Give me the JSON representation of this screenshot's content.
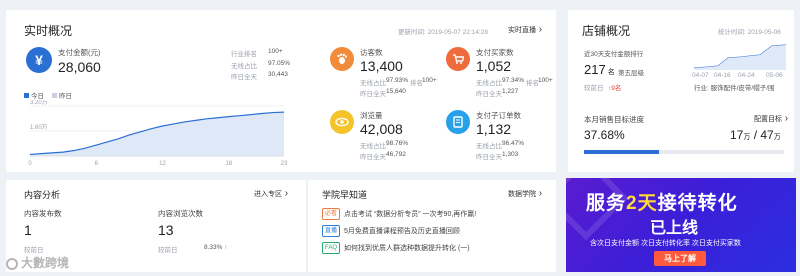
{
  "realtime": {
    "title": "实时概况",
    "updated": "更新时间: 2019-05-07 22:14:28",
    "live_link": "实时直播",
    "payment": {
      "label": "支付金额(元)",
      "value": "28,060",
      "stats": [
        {
          "label": "行业排名",
          "value": "100+"
        },
        {
          "label": "无线占比",
          "value": "97.05%"
        },
        {
          "label": "昨日全天",
          "value": "30,443"
        }
      ]
    },
    "legend_today": "今日",
    "legend_yesterday": "昨日",
    "metrics": [
      {
        "label": "访客数",
        "value": "13,400",
        "r1": "无线占比",
        "v1": "97.93%",
        "r1b": "排名",
        "v1b": "100+",
        "r2": "昨日全天",
        "v2": "15,640",
        "color": "#f08c3a",
        "icon": "footprint-icon"
      },
      {
        "label": "支付买家数",
        "value": "1,052",
        "r1": "无线占比",
        "v1": "97.34%",
        "r1b": "排名",
        "v1b": "100+",
        "r2": "昨日全天",
        "v2": "1,227",
        "color": "#ef6a3c",
        "icon": "cart-icon"
      },
      {
        "label": "浏览量",
        "value": "42,008",
        "r1": "无线占比",
        "v1": "98.76%",
        "r2": "昨日全天",
        "v2": "46,792",
        "color": "#f5c42c",
        "icon": "eye-icon"
      },
      {
        "label": "支付子订单数",
        "value": "1,132",
        "r1": "无线占比",
        "v1": "96.47%",
        "r2": "昨日全天",
        "v2": "1,303",
        "color": "#27a0e8",
        "icon": "order-icon"
      }
    ]
  },
  "chart_data": {
    "type": "area",
    "x": [
      0,
      1,
      2,
      3,
      4,
      5,
      6,
      7,
      8,
      9,
      10,
      11,
      12,
      13,
      14,
      15,
      16,
      17,
      18,
      19,
      20,
      21,
      22,
      23
    ],
    "xticks": [
      "0",
      "6",
      "12",
      "18",
      "23"
    ],
    "yticks": [
      "3.20万",
      "1.60万"
    ],
    "series": [
      {
        "name": "今日",
        "values": [
          0.1,
          0.15,
          0.2,
          0.25,
          0.35,
          0.5,
          0.7,
          0.9,
          1.1,
          1.35,
          1.55,
          1.75,
          1.92,
          2.05,
          2.18,
          2.28,
          2.38,
          2.45,
          2.52,
          2.58,
          2.65,
          2.72,
          2.78,
          2.81
        ]
      }
    ],
    "ylim": [
      0,
      3.2
    ],
    "grid": true
  },
  "shop": {
    "title": "店铺概况",
    "stat_date": "统计时间: 2019-05-06",
    "rank_label": "近30天支付金额排行",
    "rank": "217",
    "rank_unit": "名",
    "layer": "第五层级",
    "compare_label": "较前日",
    "compare_value": "9名",
    "industry": "行业: 服饰配件/皮带/帽子/围",
    "dates": [
      "04-07",
      "04-16",
      "04-24",
      "05-06"
    ],
    "sales_label": "本月销售目标进度",
    "config_link": "配置目标",
    "progress_pct": "37.68%",
    "progress": 0.3768,
    "done": "17",
    "target": "47",
    "unit": "万"
  },
  "content": {
    "title": "内容分析",
    "enter": "进入专区",
    "publish_label": "内容发布数",
    "publish_value": "1",
    "publish_compare": "较前日",
    "views_label": "内容浏览次数",
    "views_value": "13",
    "views_compare": "较前日",
    "views_pct": "8.33%"
  },
  "academy": {
    "title": "学院早知道",
    "link": "数据学院",
    "items": [
      {
        "tag": "必看",
        "text": "点击考试 “数据分析专员” 一次考90,再作赢!",
        "color": "#f07a3c"
      },
      {
        "tag": "直播",
        "text": "5月免费直播课程预告及历史直播回顾",
        "color": "#2a7fd8"
      },
      {
        "tag": "FAQ",
        "text": "如何找到优质人群选种数据提升转化 (一)",
        "color": "#2aa86a"
      }
    ]
  },
  "banner": {
    "line1a": "服务",
    "line1b": "2天",
    "line1c": "接待转化",
    "line2": "已上线",
    "sub": "含次日支付金额  次日支付转化率  次日支付买家数",
    "cta": "马上了解"
  },
  "watermark": "大數跨境"
}
